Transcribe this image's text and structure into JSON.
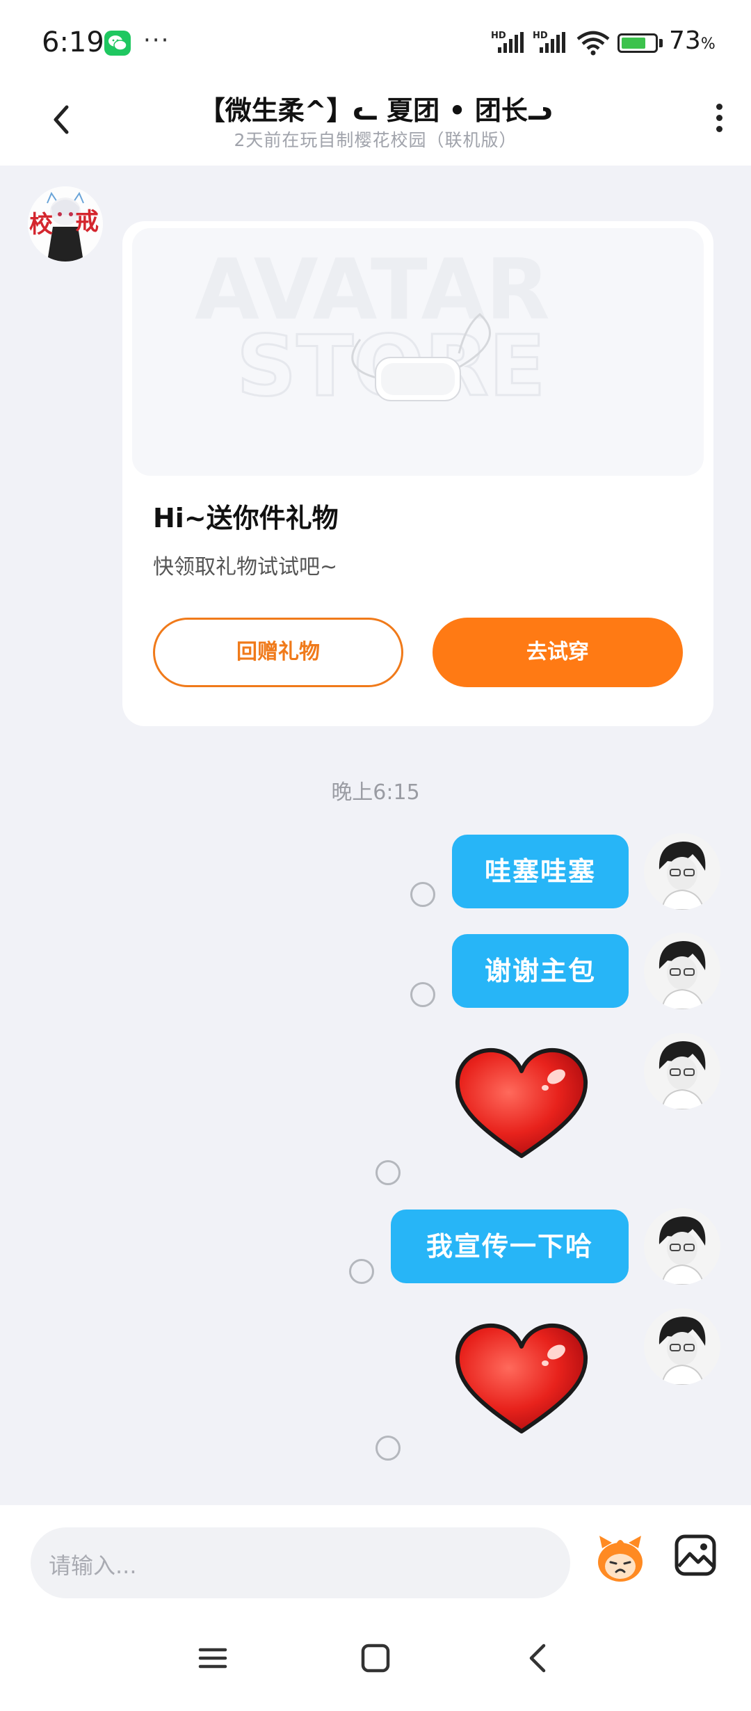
{
  "status_bar": {
    "time": "6:19",
    "more": "···",
    "signal_label_1": "HD",
    "signal_label_2": "HD",
    "battery_value": "73",
    "battery_unit": "%",
    "battery_level": 0.73,
    "notification_icon": "wechat-icon"
  },
  "header": {
    "back_icon": "chevron-left-icon",
    "title": "【微生柔^】ᓚ 夏团 • 团长ᓗ",
    "subtitle": "2天前在玩自制樱花校园（联机版）",
    "menu_icon": "more-vertical-icon"
  },
  "gift_card": {
    "image_watermark_1": "AVATAR",
    "image_watermark_2": "STORE",
    "title": "Hi~送你件礼物",
    "description": "快领取礼物试试吧~",
    "return_gift_label": "回赠礼物",
    "try_on_label": "去试穿"
  },
  "chat": {
    "time_label": "晚上6:15",
    "messages": [
      {
        "type": "text",
        "text": "哇塞哇塞"
      },
      {
        "type": "text",
        "text": "谢谢主包"
      },
      {
        "type": "sticker",
        "sticker": "heart-sticker"
      },
      {
        "type": "text",
        "text": "我宣传一下哈"
      },
      {
        "type": "sticker",
        "sticker": "heart-sticker"
      }
    ]
  },
  "input_bar": {
    "placeholder": "请输入...",
    "emoji_icon": "emoji-mascot-icon",
    "image_icon": "image-icon"
  },
  "nav_bar": {
    "menu_icon": "menu-icon",
    "home_icon": "home-square-icon",
    "back_icon": "back-triangle-icon"
  },
  "colors": {
    "accent_orange": "#ff7a14",
    "bubble_blue": "#27b5f7",
    "background": "#f1f2f7"
  }
}
